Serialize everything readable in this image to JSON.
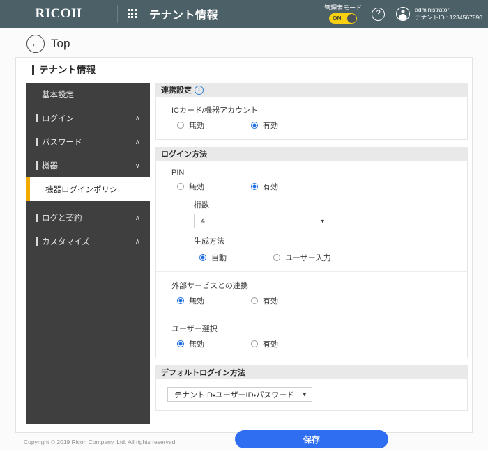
{
  "header": {
    "brand": "RICOH",
    "grid_icon": "apps-grid-icon",
    "app_title": "テナント情報",
    "admin_mode_label": "管理者モード",
    "toggle_state": "ON",
    "help_icon": "?",
    "user_name": "administrator",
    "tenant_id": "テナントID : 1234567890",
    "bar_color": "#4c6068",
    "toggle_color": "#f6d011"
  },
  "breadcrumb": {
    "back_arrow": "←",
    "label": "Top"
  },
  "card": {
    "title": "テナント情報"
  },
  "sidebar": {
    "items": [
      {
        "label": "基本設定",
        "type": "plain",
        "chevron": ""
      },
      {
        "label": "ログイン",
        "type": "group",
        "chevron": "∧"
      },
      {
        "label": "パスワード",
        "type": "group",
        "chevron": "∧"
      },
      {
        "label": "機器",
        "type": "group",
        "chevron": "∨"
      },
      {
        "label": "機器ログインポリシー",
        "type": "active",
        "chevron": ""
      },
      {
        "label": "ログと契約",
        "type": "group",
        "chevron": "∧"
      },
      {
        "label": "カスタマイズ",
        "type": "group",
        "chevron": "∧"
      }
    ],
    "active_accent": "#f2a900",
    "background": "#3f3f3f"
  },
  "sections": {
    "cooperation": {
      "title": "連携設定",
      "info_icon": "i",
      "field_label": "ICカード/機器アカウント",
      "option_disabled": "無効",
      "option_enabled": "有効",
      "selected": "有効"
    },
    "login_method": {
      "title": "ログイン方法",
      "pin": {
        "label": "PIN",
        "option_disabled": "無効",
        "option_enabled": "有効",
        "selected": "有効",
        "digits_label": "桁数",
        "digits_value": "4",
        "generation_label": "生成方法",
        "generation_auto": "自動",
        "generation_manual": "ユーザー入力",
        "generation_selected": "自動"
      },
      "external_service": {
        "label": "外部サービスとの連携",
        "option_disabled": "無効",
        "option_enabled": "有効",
        "selected": "無効"
      },
      "user_select": {
        "label": "ユーザー選択",
        "option_disabled": "無効",
        "option_enabled": "有効",
        "selected": "無効"
      }
    },
    "default_login": {
      "title": "デフォルトログイン方法",
      "value": "テナントID・ユーザーID・パスワード"
    }
  },
  "actions": {
    "save_label": "保存",
    "save_color": "#2f6ef0"
  },
  "footer": {
    "copyright": "Copyright © 2019 Ricoh Company, Ltd. All rights reserved."
  }
}
